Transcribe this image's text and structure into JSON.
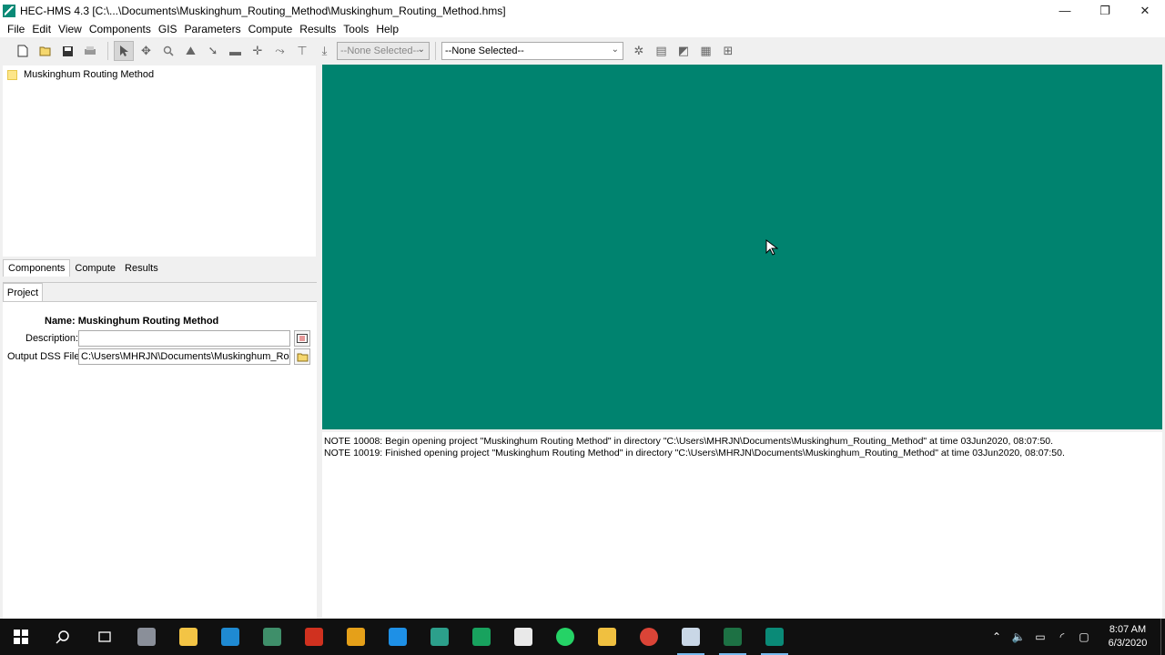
{
  "window": {
    "title": "HEC-HMS 4.3 [C:\\...\\Documents\\Muskinghum_Routing_Method\\Muskinghum_Routing_Method.hms]",
    "minimize": "—",
    "restore": "❐",
    "close": "✕"
  },
  "menu": [
    "File",
    "Edit",
    "View",
    "Components",
    "GIS",
    "Parameters",
    "Compute",
    "Results",
    "Tools",
    "Help"
  ],
  "toolbar": {
    "combo_left": "--None Selected--",
    "combo_right": "--None Selected--"
  },
  "tree": {
    "root_label": "Muskinghum Routing Method"
  },
  "tabs": [
    "Components",
    "Compute",
    "Results"
  ],
  "properties": {
    "tab_label": "Project",
    "name_label": "Name:",
    "name_value": "Muskinghum Routing Method",
    "description_label": "Description:",
    "description_value": "",
    "output_label": "Output DSS File:",
    "output_value": "C:\\Users\\MHRJN\\Documents\\Muskinghum_Routing_"
  },
  "messages": [
    "NOTE 10008:  Begin opening project \"Muskinghum Routing Method\" in directory \"C:\\Users\\MHRJN\\Documents\\Muskinghum_Routing_Method\" at time 03Jun2020, 08:07:50.",
    "NOTE 10019:  Finished opening project \"Muskinghum Routing Method\" in directory \"C:\\Users\\MHRJN\\Documents\\Muskinghum_Routing_Method\" at time 03Jun2020, 08:07:50."
  ],
  "taskbar": {
    "time": "8:07 AM",
    "date": "6/3/2020"
  },
  "colors": {
    "canvas": "#00836f",
    "taskbar": "#101010"
  }
}
